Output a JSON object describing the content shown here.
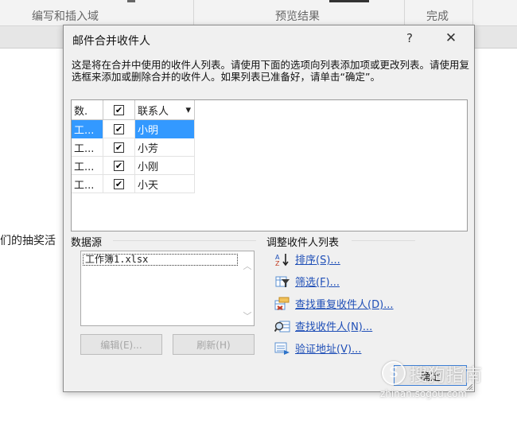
{
  "ribbon": {
    "group1": "编写和插入域",
    "group2": "预览结果",
    "group3": "完成"
  },
  "document": {
    "text": "们的抽奖活"
  },
  "dialog": {
    "title": "邮件合并收件人",
    "help": "?",
    "close": "✕",
    "description": "这是将在合并中使用的收件人列表。请使用下面的选项向列表添加项或更改列表。请使用复选框来添加或删除合并的收件人。如果列表已准备好，请单击“确定”。",
    "list": {
      "headers": {
        "source": "数.",
        "check": "✔",
        "name": "联系人",
        "sort_arrow": "▾"
      },
      "rows": [
        {
          "source": "工...",
          "checked": "✔",
          "name": "小明"
        },
        {
          "source": "工...",
          "checked": "✔",
          "name": "小芳"
        },
        {
          "source": "工...",
          "checked": "✔",
          "name": "小刚"
        },
        {
          "source": "工...",
          "checked": "✔",
          "name": "小天"
        }
      ]
    },
    "data_source": {
      "label": "数据源",
      "item": "工作簿1.xlsx",
      "edit_button": "编辑(E)...",
      "refresh_button": "刷新(H)"
    },
    "refine": {
      "label": "调整收件人列表",
      "sort": "排序(S)...",
      "filter": "筛选(F)...",
      "find_duplicates": "查找重复收件人(D)...",
      "find_recipient": "查找收件人(N)...",
      "validate": "验证地址(V)..."
    },
    "ok_button": "确定"
  },
  "watermark": {
    "text": "搜狗指南",
    "url": "zhinan.sogou.com"
  },
  "colors": {
    "selection": "#3399ff",
    "link": "#1f4fb7",
    "accent": "#3c7fd6"
  }
}
